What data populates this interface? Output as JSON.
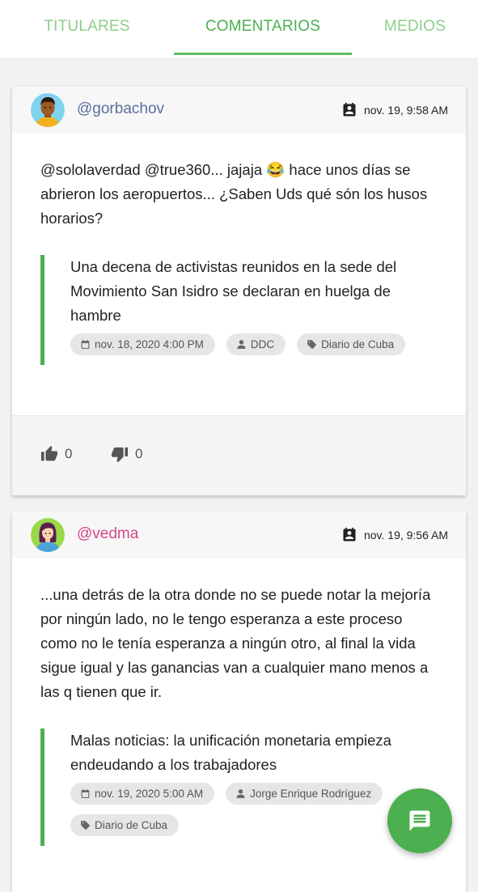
{
  "tabs": [
    {
      "label": "TITULARES"
    },
    {
      "label": "COMENTARIOS"
    },
    {
      "label": "MEDIOS"
    }
  ],
  "posts": [
    {
      "username": "@gorbachov",
      "username_color": "#5c6e9e",
      "date": "nov. 19, 9:58 AM",
      "comment": "@sololaverdad @true360... jajaja 😂 hace unos días se abrieron los aeropuertos... ¿Saben Uds qué són los husos horarios?",
      "article": {
        "title": "Una decena de activistas reunidos en la sede del Movimiento San Isidro se declaran en huelga de hambre",
        "date": "nov. 18, 2020 4:00 PM",
        "author": "DDC",
        "source": "Diario de Cuba"
      },
      "likes": "0",
      "dislikes": "0"
    },
    {
      "username": "@vedma",
      "username_color": "#d6468c",
      "date": "nov. 19, 9:56 AM",
      "comment": "...una detrás de la otra donde no se puede notar la mejoría por ningún lado, no le tengo esperanza a este proceso como no le tenía esperanza a ningún otro, al final la vida sigue igual y las ganancias van a cualquier mano menos a las q tienen que ir.",
      "article": {
        "title": "Malas noticias: la unificación monetaria empieza endeudando a los trabajadores",
        "date": "nov. 19, 2020 5:00 AM",
        "author": "Jorge Enrique Rodríguez",
        "source": "Diario de Cuba"
      }
    }
  ],
  "colors": {
    "accent": "#4caf50",
    "tab_inactive": "#8ccf8a"
  },
  "icons": {
    "date": "contact-calendar-icon",
    "chip_date": "calendar-icon",
    "chip_author": "person-icon",
    "chip_source": "tag-icon",
    "like": "thumb-up-icon",
    "dislike": "thumb-down-icon",
    "fab": "comment-icon"
  }
}
